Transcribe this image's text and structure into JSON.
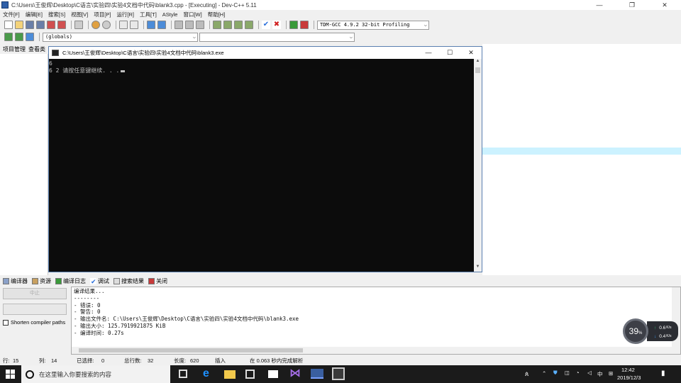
{
  "window": {
    "title": "C:\\Users\\王俊辉\\Desktop\\C语言\\实验四\\实验4文档中代码\\blank3.cpp - [Executing] - Dev-C++ 5.11",
    "controls": [
      "—",
      "❐",
      "✕"
    ]
  },
  "menu": [
    "文件[F]",
    "编辑[E]",
    "搜索[S]",
    "视图[V]",
    "项目[P]",
    "运行[R]",
    "工具[T]",
    "AStyle",
    "窗口[W]",
    "帮助[H]"
  ],
  "toolbar": {
    "compiler_select": "TDM-GCC 4.9.2 32-bit Profiling",
    "scope_select": "(globals)",
    "member_select": ""
  },
  "left_tabs": [
    "项目管理",
    "查看类"
  ],
  "console": {
    "title": "C:\\Users\\王俊辉\\Desktop\\C语言\\实验四\\实验4文档中代码\\blank3.exe",
    "line1": "6",
    "line2": "6 2 请按任意键继续. . .",
    "controls": [
      "—",
      "☐",
      "✕"
    ]
  },
  "bottom_tabs": [
    "编译器",
    "资源",
    "编译日志",
    "调试",
    "搜索结果",
    "关闭"
  ],
  "compile_panel": {
    "abort_button": "中止",
    "shorten_label": "Shorten compiler paths"
  },
  "log_lines": [
    "编译结果...",
    "--------",
    "- 错误: 0",
    "- 警告: 0",
    "- 输出文件名: C:\\Users\\王俊辉\\Desktop\\C语言\\实验四\\实验4文档中代码\\blank3.exe",
    "- 输出大小: 125.7919921875 KiB",
    "- 编译时间: 0.27s"
  ],
  "widget": {
    "percent": "39",
    "percent_unit": "%",
    "upload": "0.6",
    "download": "0.4",
    "rate_unit": "K/s"
  },
  "status": {
    "row_label": "行:",
    "row_value": "15",
    "col_label": "列:",
    "col_value": "14",
    "sel_label": "已选择:",
    "sel_value": "0",
    "lines_label": "总行数:",
    "lines_value": "32",
    "len_label": "长度:",
    "len_value": "620",
    "mode": "插入",
    "parse_info": "在 0.063 秒内完成解析"
  },
  "taskbar": {
    "search_placeholder": "在这里输入你要搜索的内容",
    "clock_time": "12:42",
    "clock_date": "2019/12/3",
    "ime": "中"
  },
  "colors": {
    "editor_highlight": "#ccf2ff",
    "console_bg": "#0c0c0c",
    "taskbar_bg": "#1b1b1b"
  }
}
